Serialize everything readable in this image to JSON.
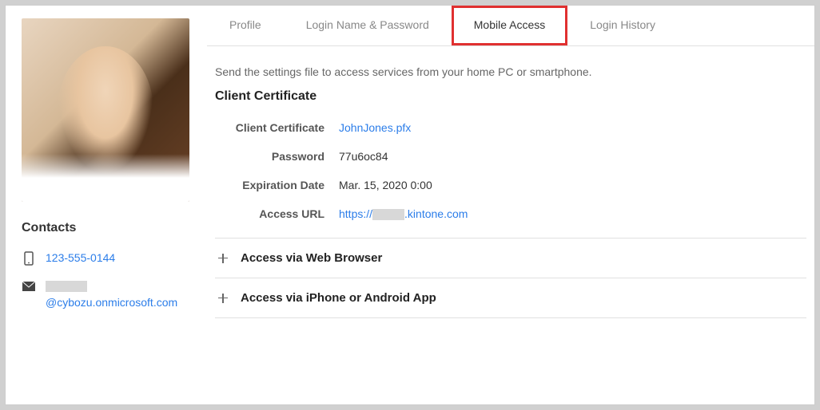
{
  "sidebar": {
    "contacts_heading": "Contacts",
    "phone": "123-555-0144",
    "email_suffix": "@cybozu.onmicrosoft.com"
  },
  "tabs": [
    {
      "label": "Profile"
    },
    {
      "label": "Login Name & Password"
    },
    {
      "label": "Mobile Access"
    },
    {
      "label": "Login History"
    }
  ],
  "content": {
    "description": "Send the settings file to access services from your home PC or smartphone.",
    "section_title": "Client Certificate",
    "fields": {
      "cert_label": "Client Certificate",
      "cert_value": "JohnJones.pfx",
      "password_label": "Password",
      "password_value": "77u6oc84",
      "expiration_label": "Expiration Date",
      "expiration_value": "Mar. 15, 2020 0:00",
      "url_label": "Access URL",
      "url_prefix": "https://",
      "url_suffix": ".kintone.com"
    },
    "accordion": [
      {
        "title": "Access via Web Browser"
      },
      {
        "title": "Access via iPhone or Android App"
      }
    ]
  }
}
